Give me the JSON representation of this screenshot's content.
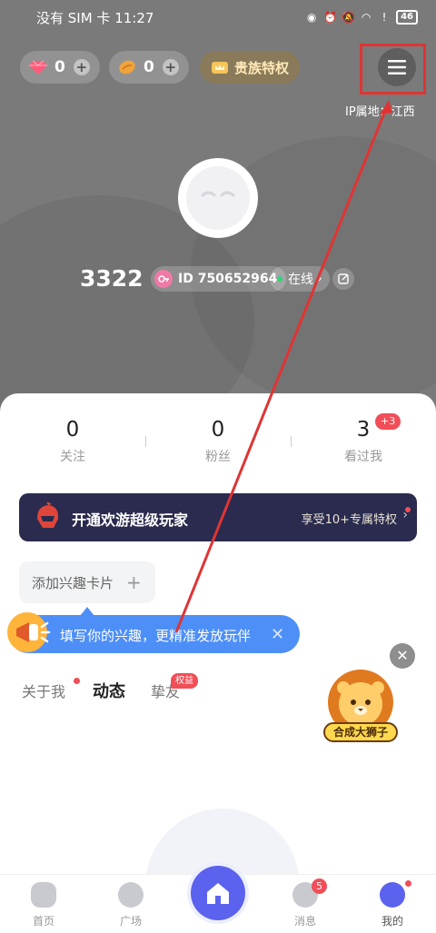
{
  "status_bar": {
    "carrier": "没有 SIM 卡",
    "time": "11:27",
    "battery": "46"
  },
  "wallet": {
    "diamonds": "0",
    "beans": "0",
    "noble_label": "贵族特权"
  },
  "ip_location": "IP属地：江西",
  "profile": {
    "username": "3322",
    "id_label": "ID 750652964",
    "online_label": "在线"
  },
  "stats": [
    {
      "value": "0",
      "label": "关注"
    },
    {
      "value": "0",
      "label": "粉丝"
    },
    {
      "value": "3",
      "label": "看过我"
    }
  ],
  "visitors_badge": "+3",
  "vip_banner": {
    "title": "开通欢游超级玩家",
    "desc": "享受10+专属特权"
  },
  "interest": {
    "add_label": "添加兴趣卡片",
    "tip": "填写你的兴趣，更精准发放玩伴"
  },
  "tabs": {
    "about": "关于我",
    "dynamic": "动态",
    "friends": "挚友",
    "rights_badge": "权益"
  },
  "lion_widget": {
    "label": "合成大狮子"
  },
  "bottom_nav": {
    "home": "首页",
    "square": "广场",
    "messages": "消息",
    "mine": "我的",
    "messages_badge": "5"
  },
  "colors": {
    "accent": "#5a62ee",
    "highlight": "#e03434",
    "tip_blue": "#4d8ff7",
    "badge_red": "#f14e58"
  }
}
